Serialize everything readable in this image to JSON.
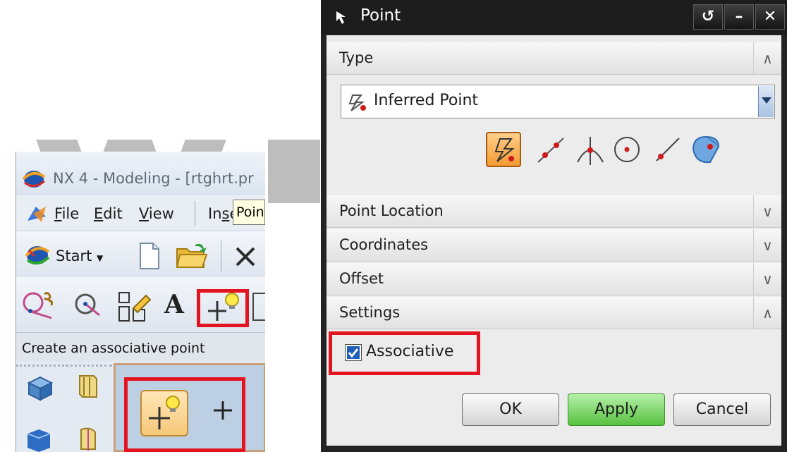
{
  "nx_window": {
    "title": "NX 4 - Modeling - [rtghrt.pr",
    "menu": {
      "file": {
        "hot": "F",
        "rest": "ile"
      },
      "edit": {
        "hot": "E",
        "rest": "dit"
      },
      "view": {
        "hot": "V",
        "rest": "iew"
      },
      "insert": {
        "pre": "In",
        "hot": "s",
        "rest": "er"
      }
    },
    "start_label": "Start",
    "status_text": "Create an associative poi",
    "status_text_tail": "nt",
    "tooltip": "Point"
  },
  "point_dialog": {
    "title": "Point",
    "title_buttons": {
      "reset": "↺",
      "minimize": "–",
      "close": "✕"
    },
    "sections": {
      "type": "Type",
      "point_location": "Point Location",
      "coordinates": "Coordinates",
      "offset": "Offset",
      "settings": "Settings"
    },
    "type_selected": "Inferred Point",
    "associative_label": "Associative",
    "associative_checked": true,
    "buttons": {
      "ok": "OK",
      "apply": "Apply",
      "cancel": "Cancel"
    }
  },
  "colors": {
    "highlight_box": "#e3141f",
    "apply_button": "#56c140",
    "dialog_frame": "#232323"
  },
  "icons": [
    "nx-logo-icon",
    "start-icon",
    "new-file-icon",
    "open-folder-icon",
    "close-icon",
    "point-icon",
    "point-on-curve-icon",
    "intersection-point-icon",
    "arc-center-icon",
    "end-point-icon",
    "face-point-icon"
  ]
}
